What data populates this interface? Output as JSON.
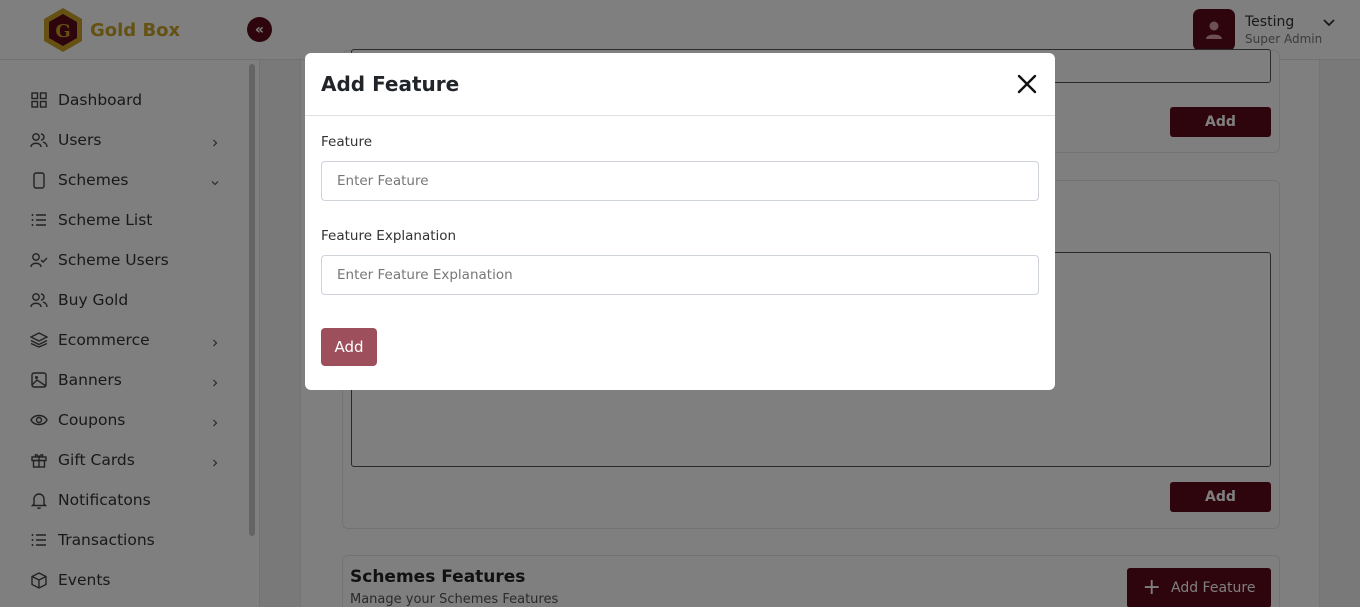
{
  "brand": {
    "name": "Gold Box",
    "logo_letter": "G"
  },
  "user": {
    "name": "Testing",
    "role": "Super Admin"
  },
  "sidebar": {
    "items": [
      {
        "label": "Dashboard",
        "icon": "grid-icon",
        "has_chevron": false
      },
      {
        "label": "Users",
        "icon": "users-icon",
        "has_chevron": true
      },
      {
        "label": "Schemes",
        "icon": "phone-icon",
        "has_chevron": true
      },
      {
        "label": "Scheme List",
        "icon": "list-icon",
        "has_chevron": false
      },
      {
        "label": "Scheme Users",
        "icon": "user-check-icon",
        "has_chevron": false
      },
      {
        "label": "Buy Gold",
        "icon": "users-icon",
        "has_chevron": false
      },
      {
        "label": "Ecommerce",
        "icon": "layers-icon",
        "has_chevron": true
      },
      {
        "label": "Banners",
        "icon": "image-icon",
        "has_chevron": true
      },
      {
        "label": "Coupons",
        "icon": "eye-icon",
        "has_chevron": true
      },
      {
        "label": "Gift Cards",
        "icon": "gift-icon",
        "has_chevron": true
      },
      {
        "label": "Notificatons",
        "icon": "bell-icon",
        "has_chevron": false
      },
      {
        "label": "Transactions",
        "icon": "list-icon",
        "has_chevron": false
      },
      {
        "label": "Events",
        "icon": "box-icon",
        "has_chevron": false
      }
    ]
  },
  "main": {
    "top_add_label": "Add",
    "middle_add_label": "Add",
    "features": {
      "title": "Schemes Features",
      "subtitle": "Manage your Schemes Features",
      "add_button_label": "Add Feature"
    }
  },
  "modal": {
    "title": "Add Feature",
    "feature_label": "Feature",
    "feature_placeholder": "Enter Feature",
    "explanation_label": "Feature Explanation",
    "explanation_placeholder": "Enter Feature Explanation",
    "submit_label": "Add"
  },
  "colors": {
    "brand": "#5c0a1a",
    "gold": "#c9a227",
    "submit_disabled": "#9e4f5c"
  }
}
